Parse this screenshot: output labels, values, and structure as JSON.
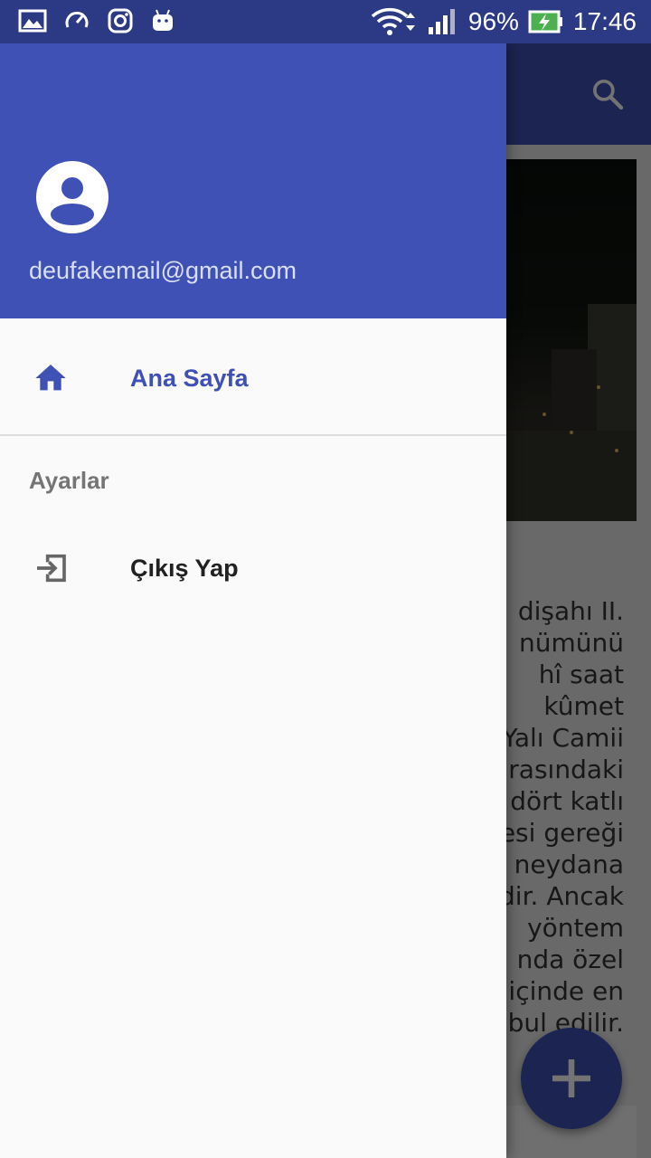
{
  "status_bar": {
    "battery_percent": "96%",
    "time": "17:46",
    "icons": [
      "gallery-icon",
      "speedometer-icon",
      "instagram-icon",
      "android-icon",
      "wifi-icon",
      "signal-icon",
      "battery-charging-icon"
    ]
  },
  "app": {
    "article_lines": [
      "dişahı II.",
      "nümünü",
      "hî saat",
      "kûmet",
      "Yalı Camii",
      "arasındaki",
      "dört katlı",
      "esi gereği",
      "neydana",
      "dir. Ancak",
      "yöntem",
      "nda özel",
      "i içinde en",
      "bul edilir."
    ],
    "fab_icon": "plus-icon",
    "search_icon": "search-icon"
  },
  "drawer": {
    "email": "deufakemail@gmail.com",
    "items": [
      {
        "label": "Ana Sayfa",
        "icon": "home-icon",
        "selected": true
      },
      {
        "label": "Çıkış Yap",
        "icon": "exit-icon",
        "selected": false
      }
    ],
    "section_title": "Ayarlar"
  },
  "colors": {
    "primary": "#3f51b5",
    "status_bar": "#2c3a86",
    "drawer_bg": "#fafafa"
  }
}
